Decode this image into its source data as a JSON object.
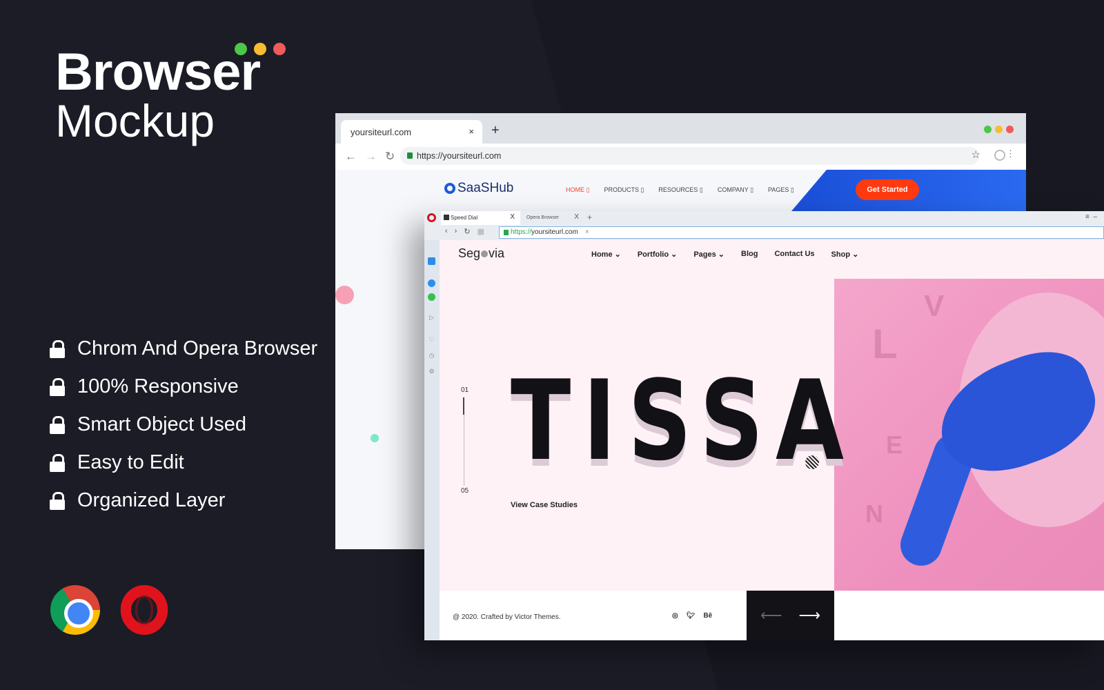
{
  "promo": {
    "title_line1": "Browser",
    "title_line2": "Mockup",
    "dot_colors": [
      "#4cc749",
      "#f5bd2f",
      "#ef5a5a"
    ],
    "features": [
      "Chrom And Opera Browser",
      "100% Responsive",
      "Smart Object Used",
      "Easy to Edit",
      "Organized Layer"
    ]
  },
  "chrome": {
    "tab_title": "yoursiteurl.com",
    "tab_close": "×",
    "new_tab": "+",
    "url": "https://yoursiteurl.com",
    "site": {
      "logo": "SaaSHub",
      "nav": [
        "HOME ▯",
        "PRODUCTS ▯",
        "RESOURCES ▯",
        "COMPANY ▯",
        "PAGES ▯"
      ],
      "cta": "Get Started"
    }
  },
  "opera": {
    "tabs": [
      {
        "label": "Speed Dial",
        "close": "X"
      },
      {
        "label": "Opera Browser",
        "close": "X"
      }
    ],
    "new_tab": "+",
    "url_scheme": "https://",
    "url_host": "yoursiteurl.com",
    "url_clear": "×",
    "site": {
      "logo_pre": "Seg",
      "logo_post": "via",
      "nav": [
        "Home ⌄",
        "Portfolio ⌄",
        "Pages ⌄",
        "Blog",
        "Contact Us",
        "Shop ⌄"
      ],
      "hero": "TISSA",
      "slide_current": "01",
      "slide_total": "05",
      "cta": "View Case Studies",
      "photo_letters": [
        "V",
        "L",
        "E",
        "N"
      ],
      "footer": "@ 2020. Crafted by Victor Themes.",
      "social": [
        "instagram",
        "twitter",
        "Bē"
      ],
      "prev": "⟵",
      "next": "⟶"
    }
  }
}
